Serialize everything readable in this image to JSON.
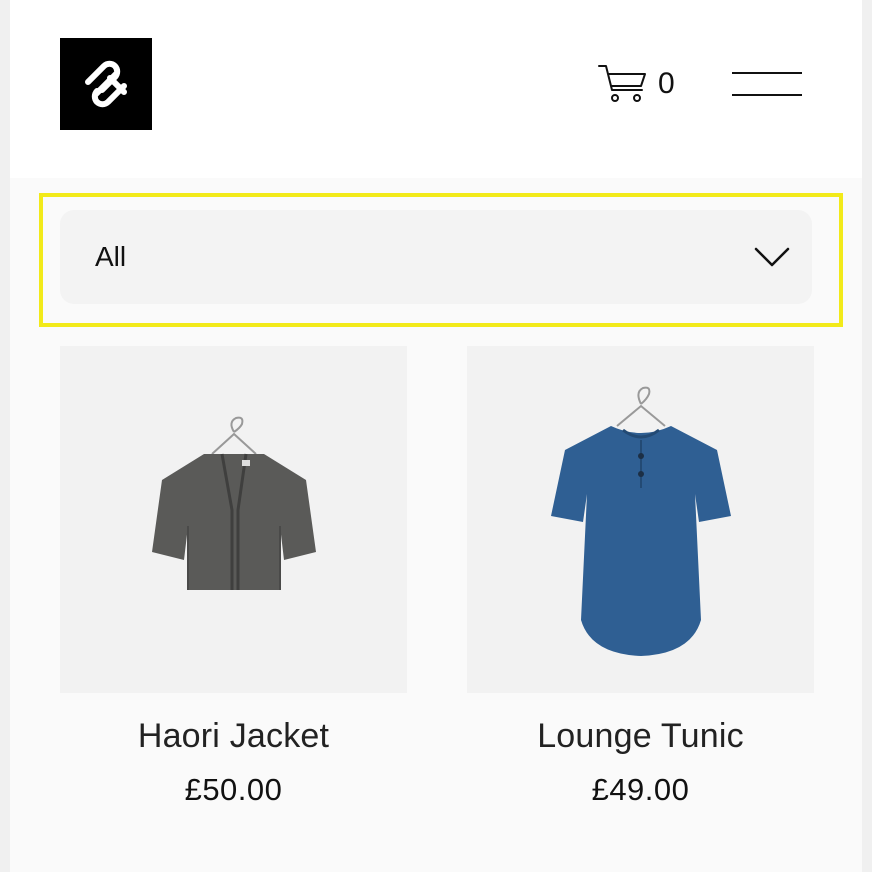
{
  "header": {
    "logo_icon": "squarespace-logo-icon",
    "cart_icon": "cart-icon",
    "cart_count": "0",
    "menu_icon": "hamburger-menu-icon"
  },
  "filter": {
    "selected": "All",
    "chevron_icon": "chevron-down-icon",
    "highlight_color": "#f2ea19"
  },
  "products": [
    {
      "name": "Haori Jacket",
      "price": "£50.00",
      "image": "grey-haori-jacket-on-hanger"
    },
    {
      "name": "Lounge Tunic",
      "price": "£49.00",
      "image": "blue-lounge-tunic-on-hanger"
    }
  ],
  "colors": {
    "background": "#fafafa",
    "header_background": "#ffffff",
    "text": "#111111",
    "jacket": "#5a5a58",
    "tunic": "#2f5f93"
  }
}
